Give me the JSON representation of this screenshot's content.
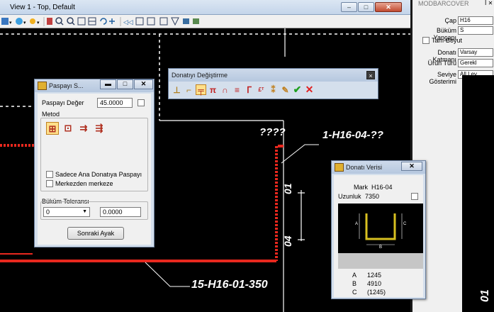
{
  "view_window": {
    "title": "View 1 - Top, Default",
    "buttons": {
      "minimize": "–",
      "maximize": "□",
      "close": "✕"
    }
  },
  "canvas": {
    "label_top": "????",
    "label_top_right": "1-H16-04-??",
    "label_dim_right": "01",
    "label_dim_left": "04",
    "label_bottom": "15-H16-01-350",
    "label_edge": "01"
  },
  "right_panel": {
    "title": "MODBARCOVER",
    "pin": "ꟾ ✕",
    "cap_label": "Çap",
    "cap_value": "H16",
    "bukum_label": "Büküm Yançapı",
    "bukum_value": "S",
    "tam_boyut_label": "Tam-Boyut",
    "donati_katmani_label": "Donatı Katmanı",
    "donati_katmani_value": "Varsay",
    "urun_turu_label": "Ürün Türü",
    "urun_turu_value": "Gerekl",
    "seviye_label": "Seviye Gösterimi",
    "seviye_value": "All Lev"
  },
  "donatiyi_degistirme": {
    "title": "Donatıyı Değiştirme",
    "close": "×",
    "tools": [
      "trim-tool",
      "corner-tool",
      "hook-tool",
      "stirrup-tool",
      "bend-tool",
      "lap-tool",
      "anchor-tool",
      "text-tool",
      "split-tool",
      "edit-tool",
      "accept-tool",
      "cancel-tool"
    ]
  },
  "paspayi_window": {
    "title": "Paspayı S...",
    "paspayi_deger_label": "Paspayı Değer",
    "paspayi_deger_value": "45.0000",
    "metod_label": "Metod",
    "sadece_label": "Sadece Ana Donatıya Paspayı",
    "merkezden_label": "Merkezden merkeze",
    "bukum_toleransi_label": "Büküm Toleransı",
    "bukum_select": "0",
    "bukum_value": "0.0000",
    "sonraki_button": "Sonraki Ayak"
  },
  "donati_verisi": {
    "title": "Donatı Verisi",
    "close": "✕",
    "mark_label": "Mark",
    "mark_value": "H16-04",
    "uzunluk_label": "Uzunluk",
    "uzunluk_value": "7350",
    "dims": [
      {
        "label": "A",
        "value": "1245"
      },
      {
        "label": "B",
        "value": "4910"
      },
      {
        "label": "C",
        "value": "(1245)"
      }
    ],
    "shape_labels": {
      "a": "A",
      "b": "B",
      "c": "C"
    }
  },
  "colors": {
    "rebar_red": "#e8281e",
    "canvas_bg": "#000000",
    "white_line": "#ffffff",
    "panel_bg": "#f0f0f0",
    "title_blue": "#c4d5ea",
    "rebar_yellow": "#d8c020"
  }
}
